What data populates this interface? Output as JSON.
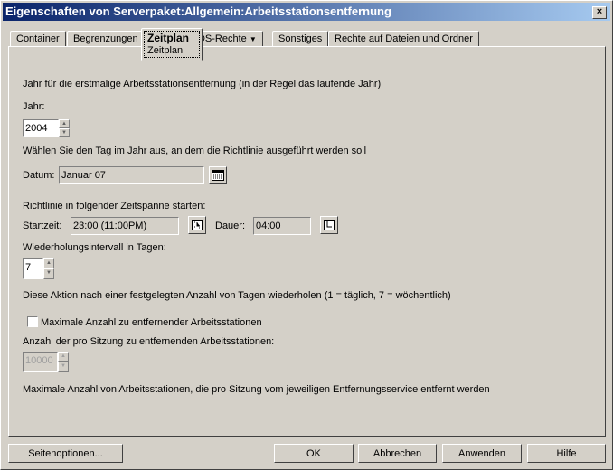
{
  "window": {
    "title": "Eigenschaften von Serverpaket:Allgemein:Arbeitsstationsentfernung",
    "close": "×"
  },
  "tabs": [
    {
      "label": "Container"
    },
    {
      "label": "Begrenzungen"
    },
    {
      "label": "Zeitplan",
      "sub": "Zeitplan"
    },
    {
      "label": "NDS-Rechte",
      "arrow": "▼"
    },
    {
      "label": "Sonstiges"
    },
    {
      "label": "Rechte auf Dateien und Ordner"
    }
  ],
  "form": {
    "year_heading": "Jahr für die erstmalige Arbeitsstationsentfernung (in der Regel das laufende Jahr)",
    "year_label": "Jahr:",
    "year_value": "2004",
    "day_heading": "Wählen Sie den Tag im Jahr aus, an dem die Richtlinie ausgeführt werden soll",
    "date_label": "Datum:",
    "date_value": "Januar 07",
    "timespan_heading": "Richtlinie in folgender Zeitspanne starten:",
    "start_label": "Startzeit:",
    "start_value": "23:00 (11:00PM)",
    "duration_label": "Dauer:",
    "duration_value": "04:00",
    "interval_label": "Wiederholungsintervall in Tagen:",
    "interval_value": "7",
    "interval_help": "Diese Aktion nach einer festgelegten Anzahl von Tagen wiederholen (1 = täglich, 7 = wöchentlich)",
    "max_checkbox_label": "Maximale Anzahl zu entfernender Arbeitsstationen",
    "max_checked": false,
    "per_session_label": "Anzahl der pro Sitzung zu entfernenden Arbeitsstationen:",
    "per_session_value": "10000",
    "per_session_help": "Maximale Anzahl von Arbeitsstationen, die pro Sitzung vom jeweiligen Entfernungsservice entfernt werden"
  },
  "buttons": {
    "page_options": "Seitenoptionen...",
    "ok": "OK",
    "cancel": "Abbrechen",
    "apply": "Anwenden",
    "help": "Hilfe"
  }
}
